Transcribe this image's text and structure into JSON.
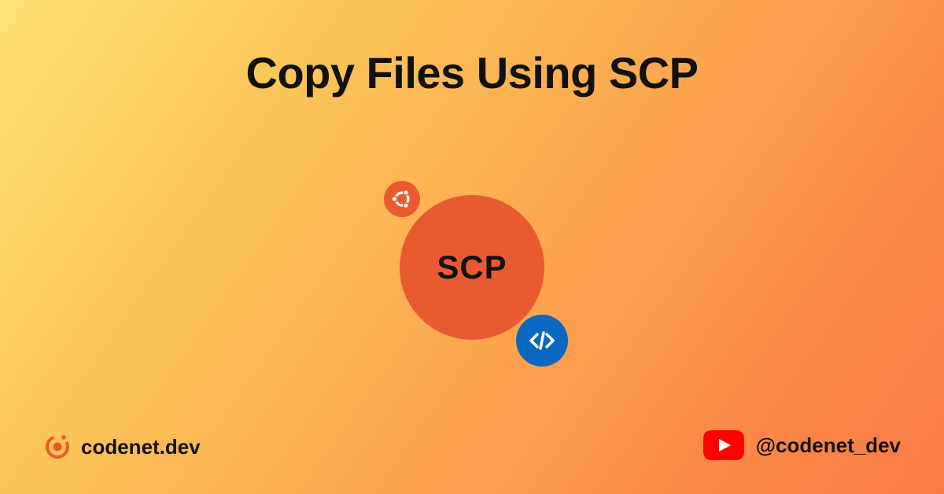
{
  "title": "Copy Files Using SCP",
  "center": {
    "label": "SCP"
  },
  "footer": {
    "brand": "codenet.dev",
    "handle": "@codenet_dev"
  },
  "colors": {
    "accent_orange": "#ea5a30",
    "accent_blue": "#0b68c1",
    "youtube_red": "#ff0000"
  }
}
